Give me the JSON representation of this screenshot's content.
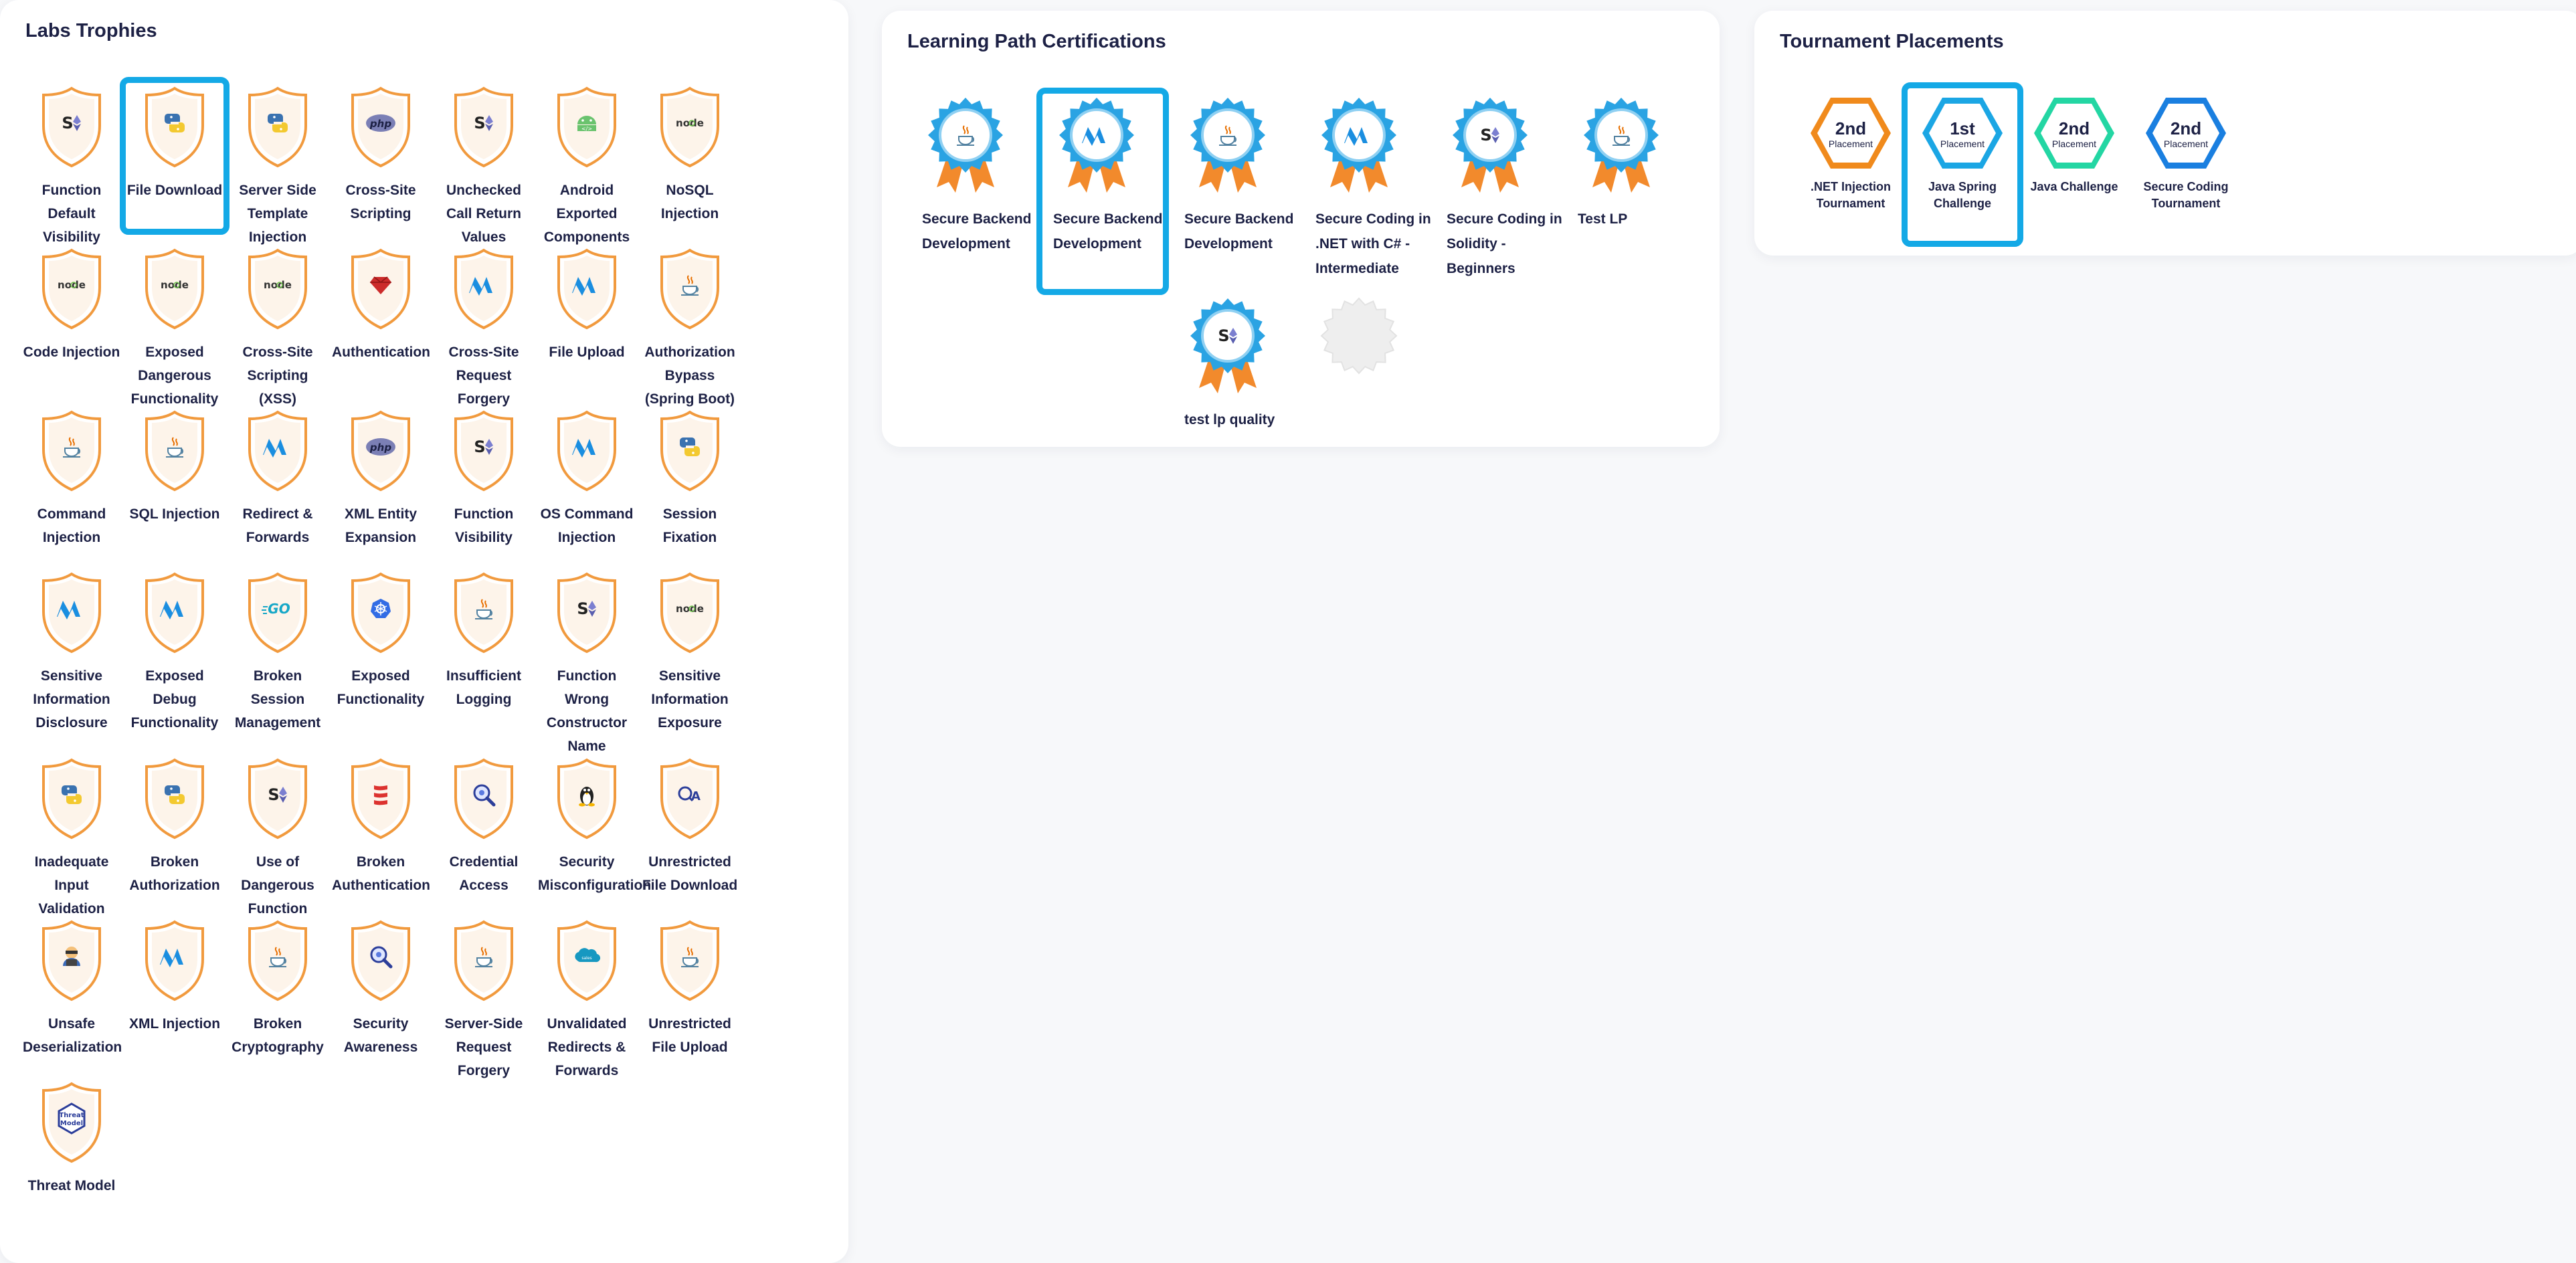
{
  "labs": {
    "title": "Labs Trophies",
    "items": [
      {
        "label": "Function Default Visibility",
        "icon": "solidity-icon",
        "highlight": false
      },
      {
        "label": "File Download",
        "icon": "python-icon",
        "highlight": true
      },
      {
        "label": "Server Side Template Injection",
        "icon": "python-icon",
        "highlight": false
      },
      {
        "label": "Cross-Site Scripting",
        "icon": "php-icon",
        "highlight": false
      },
      {
        "label": "Unchecked Call Return Values",
        "icon": "solidity-icon",
        "highlight": false
      },
      {
        "label": "Android Exported Components",
        "icon": "android-icon",
        "highlight": false
      },
      {
        "label": "NoSQL Injection",
        "icon": "node-icon",
        "highlight": false
      },
      {
        "label": "Code Injection",
        "icon": "node-icon",
        "highlight": false
      },
      {
        "label": "Exposed Dangerous Functionality",
        "icon": "node-icon",
        "highlight": false
      },
      {
        "label": "Cross-Site Scripting (XSS)",
        "icon": "node-icon",
        "highlight": false
      },
      {
        "label": "Authentication",
        "icon": "ruby-icon",
        "highlight": false
      },
      {
        "label": "Cross-Site Request Forgery",
        "icon": "dotnet-icon",
        "highlight": false
      },
      {
        "label": "File Upload",
        "icon": "dotnet-icon",
        "highlight": false
      },
      {
        "label": "Authorization Bypass (Spring Boot)",
        "icon": "java-icon",
        "highlight": false
      },
      {
        "label": "Command Injection",
        "icon": "java-icon",
        "highlight": false
      },
      {
        "label": "SQL Injection",
        "icon": "java-icon",
        "highlight": false
      },
      {
        "label": "Redirect & Forwards",
        "icon": "dotnet-icon",
        "highlight": false
      },
      {
        "label": "XML Entity Expansion",
        "icon": "php-icon",
        "highlight": false
      },
      {
        "label": "Function Visibility",
        "icon": "solidity-icon",
        "highlight": false
      },
      {
        "label": "OS Command Injection",
        "icon": "dotnet-icon",
        "highlight": false
      },
      {
        "label": "Session Fixation",
        "icon": "python-icon",
        "highlight": false
      },
      {
        "label": "Sensitive Information Disclosure",
        "icon": "dotnet-icon",
        "highlight": false
      },
      {
        "label": "Exposed Debug Functionality",
        "icon": "dotnet-icon",
        "highlight": false
      },
      {
        "label": "Broken Session Management",
        "icon": "go-icon",
        "highlight": false
      },
      {
        "label": "Exposed Functionality",
        "icon": "kubernetes-icon",
        "highlight": false
      },
      {
        "label": "Insufficient Logging",
        "icon": "java-icon",
        "highlight": false
      },
      {
        "label": "Function Wrong Constructor Name",
        "icon": "solidity-icon",
        "highlight": false
      },
      {
        "label": "Sensitive Information Exposure",
        "icon": "node-icon",
        "highlight": false
      },
      {
        "label": "Inadequate Input Validation",
        "icon": "python-icon",
        "highlight": false
      },
      {
        "label": "Broken Authorization",
        "icon": "python-icon",
        "highlight": false
      },
      {
        "label": "Use of Dangerous Function",
        "icon": "solidity-icon",
        "highlight": false
      },
      {
        "label": "Broken Authentication",
        "icon": "scala-icon",
        "highlight": false
      },
      {
        "label": "Credential Access",
        "icon": "magnifier-icon",
        "highlight": false
      },
      {
        "label": "Security Misconfiguration",
        "icon": "linux-icon",
        "highlight": false
      },
      {
        "label": "Unrestricted File Download",
        "icon": "qa-icon",
        "highlight": false
      },
      {
        "label": "Unsafe Deserialization",
        "icon": "hacker-icon",
        "highlight": false
      },
      {
        "label": "XML Injection",
        "icon": "dotnet-icon",
        "highlight": false
      },
      {
        "label": "Broken Cryptography",
        "icon": "java-icon",
        "highlight": false
      },
      {
        "label": "Security Awareness",
        "icon": "magnifier-icon",
        "highlight": false
      },
      {
        "label": "Server-Side Request Forgery",
        "icon": "java-icon",
        "highlight": false
      },
      {
        "label": "Unvalidated Redirects & Forwards",
        "icon": "salesforce-icon",
        "highlight": false
      },
      {
        "label": "Unrestricted File Upload",
        "icon": "java-icon",
        "highlight": false
      },
      {
        "label": "Threat Model",
        "icon": "threat-model-icon",
        "highlight": false
      }
    ]
  },
  "learning_path": {
    "title": "Learning Path Certifications",
    "items": [
      {
        "label": "Secure Backend Development",
        "icon": "java-icon",
        "highlight": false,
        "locked": false
      },
      {
        "label": "Secure Backend Development",
        "icon": "dotnet-icon",
        "highlight": true,
        "locked": false
      },
      {
        "label": "Secure Backend Development",
        "icon": "java-icon",
        "highlight": false,
        "locked": false
      },
      {
        "label": "Secure Coding in .NET with C# - Intermediate",
        "icon": "dotnet-icon",
        "highlight": false,
        "locked": false
      },
      {
        "label": "Secure Coding in Solidity - Beginners",
        "icon": "solidity-icon",
        "highlight": false,
        "locked": false
      },
      {
        "label": "Test LP",
        "icon": "java-icon",
        "highlight": false,
        "locked": false
      },
      {
        "label": "",
        "icon": "",
        "highlight": false,
        "spacer": true
      },
      {
        "label": "",
        "icon": "",
        "highlight": false,
        "spacer": true
      },
      {
        "label": "test lp quality",
        "icon": "solidity-icon",
        "highlight": false,
        "locked": false
      },
      {
        "label": "",
        "icon": "locked-badge-icon",
        "highlight": false,
        "locked": true
      }
    ]
  },
  "tournaments": {
    "title": "Tournament Placements",
    "placement_word": "Placement",
    "items": [
      {
        "rank": "2nd",
        "label": ".NET Injection Tournament",
        "color": "#f08a1c",
        "highlight": false
      },
      {
        "rank": "1st",
        "label": "Java Spring Challenge",
        "color": "#1ba6e4",
        "highlight": true
      },
      {
        "rank": "2nd",
        "label": "Java Challenge",
        "color": "#23d6a3",
        "highlight": false
      },
      {
        "rank": "2nd",
        "label": "Secure Coding Tournament",
        "color": "#1a7fe0",
        "highlight": false
      }
    ]
  },
  "colors": {
    "highlight": "#14a9e6",
    "shield_border": "#f19a3e",
    "rosette": "#2aa3e3",
    "ribbon": "#f28a2c"
  }
}
